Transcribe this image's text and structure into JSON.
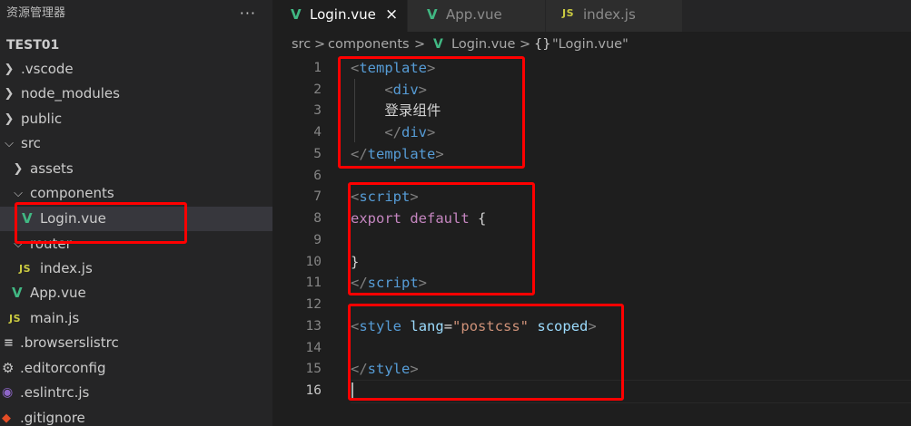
{
  "explorer": {
    "title": "资源管理器",
    "more": "···",
    "project": "TEST01",
    "items": [
      {
        "label": ".vscode",
        "icon": "chevron-right",
        "kind": "folder"
      },
      {
        "label": "node_modules",
        "icon": "chevron-right",
        "kind": "folder"
      },
      {
        "label": "public",
        "icon": "chevron-right",
        "kind": "folder"
      },
      {
        "label": "src",
        "icon": "chevron-down",
        "kind": "folder"
      },
      {
        "label": "assets",
        "icon": "chevron-right",
        "kind": "folder"
      },
      {
        "label": "components",
        "icon": "chevron-down",
        "kind": "folder"
      },
      {
        "label": "Login.vue",
        "icon": "vue-file-icon",
        "kind": "file",
        "selected": true
      },
      {
        "label": "router",
        "icon": "chevron-down",
        "kind": "folder"
      },
      {
        "label": "index.js",
        "icon": "js-file-icon",
        "kind": "file",
        "badge": "JS"
      },
      {
        "label": "App.vue",
        "icon": "vue-file-icon",
        "kind": "file"
      },
      {
        "label": "main.js",
        "icon": "js-file-icon",
        "kind": "file",
        "badge": "JS"
      },
      {
        "label": ".browserslistrc",
        "icon": "lines-icon",
        "kind": "file"
      },
      {
        "label": ".editorconfig",
        "icon": "gear-icon",
        "kind": "file"
      },
      {
        "label": ".eslintrc.js",
        "icon": "eslint-icon",
        "kind": "file"
      },
      {
        "label": ".gitignore",
        "icon": "git-icon",
        "kind": "file"
      }
    ]
  },
  "tabs": [
    {
      "label": "Login.vue",
      "icon": "vue-file-icon",
      "active": true,
      "close": "×"
    },
    {
      "label": "App.vue",
      "icon": "vue-file-icon",
      "active": false
    },
    {
      "label": "index.js",
      "icon": "js-file-icon",
      "badge": "JS",
      "active": false
    }
  ],
  "breadcrumb": {
    "parts": [
      "src",
      "components",
      "Login.vue"
    ],
    "separator": ">",
    "symbol_icon": "{}",
    "symbol": "\"Login.vue\""
  },
  "editor": {
    "current_line": 16,
    "lines": [
      {
        "n": "1"
      },
      {
        "n": "2"
      },
      {
        "n": "3"
      },
      {
        "n": "4"
      },
      {
        "n": "5"
      },
      {
        "n": "6"
      },
      {
        "n": "7"
      },
      {
        "n": "8"
      },
      {
        "n": "9"
      },
      {
        "n": "10"
      },
      {
        "n": "11"
      },
      {
        "n": "12"
      },
      {
        "n": "13"
      },
      {
        "n": "14"
      },
      {
        "n": "15"
      },
      {
        "n": "16"
      }
    ],
    "tokens": {
      "l1_open": "<",
      "l1_tag": "template",
      "l1_close": ">",
      "l2_open": "<",
      "l2_tag": "div",
      "l2_close": ">",
      "l3_text": "登录组件",
      "l4_open": "</",
      "l4_tag": "div",
      "l4_close": ">",
      "l5_open": "</",
      "l5_tag": "template",
      "l5_close": ">",
      "l7_open": "<",
      "l7_tag": "script",
      "l7_close": ">",
      "l8_kw1": "export",
      "l8_kw2": "default",
      "l8_brace": "{",
      "l10_brace": "}",
      "l11_open": "</",
      "l11_tag": "script",
      "l11_close": ">",
      "l13_open": "<",
      "l13_tag": "style",
      "l13_attr1": "lang",
      "l13_eq": "=",
      "l13_val": "\"postcss\"",
      "l13_attr2": "scoped",
      "l13_close": ">",
      "l15_open": "</",
      "l15_tag": "style",
      "l15_close": ">"
    }
  },
  "colors": {
    "annotation": "#ff0000",
    "vue_icon": "#41b883",
    "js_icon": "#cbcb41",
    "tag": "#569cd6",
    "keyword": "#c586c0",
    "attribute": "#9cdcfe",
    "string": "#ce9178"
  }
}
